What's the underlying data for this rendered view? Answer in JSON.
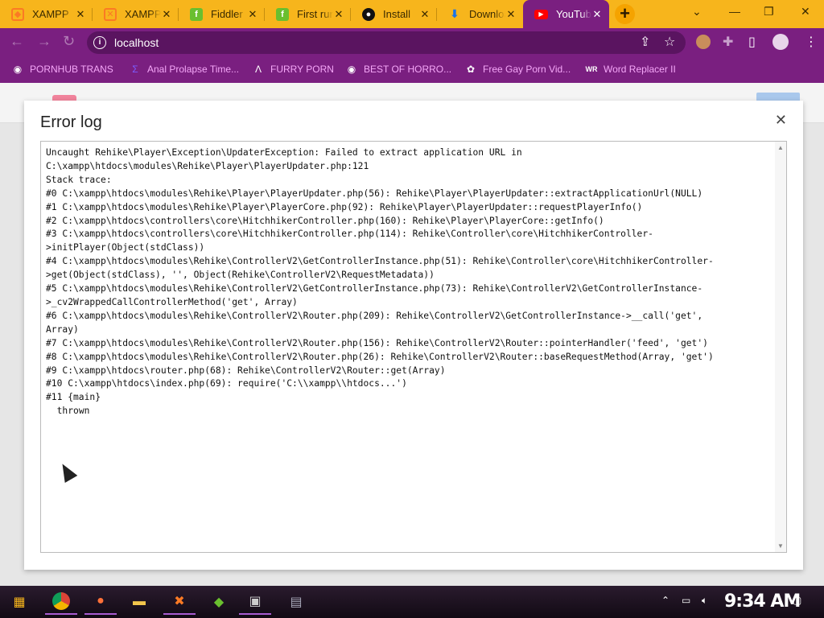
{
  "browser": {
    "tabs": [
      {
        "label": "XAMPP",
        "icon": "xampp-icon",
        "color": "#fb7a24"
      },
      {
        "label": "XAMPP",
        "icon": "xampp-icon",
        "color": "#fb7a24"
      },
      {
        "label": "Fiddler",
        "icon": "fiddler-icon",
        "color": "#6abf2f"
      },
      {
        "label": "First run",
        "icon": "fiddler-icon",
        "color": "#6abf2f"
      },
      {
        "label": "Install",
        "icon": "github-icon",
        "color": "#111111"
      },
      {
        "label": "Downloads",
        "icon": "download-icon",
        "color": "#1a73e8"
      },
      {
        "label": "YouTube",
        "icon": "youtube-icon",
        "color": "#ff0000"
      }
    ],
    "close_glyph": "✕",
    "new_tab_glyph": "+",
    "address": "localhost",
    "accent_color": "#7a1f80",
    "tabstrip_color": "#f7b51c"
  },
  "bookmarks": [
    {
      "label": "PORNHUB TRANS",
      "icon": "globe-icon"
    },
    {
      "label": "Anal Prolapse Time...",
      "icon": "bookmark-icon"
    },
    {
      "label": "FURRY PORN",
      "icon": "arrow-logo-icon"
    },
    {
      "label": "BEST OF HORRO...",
      "icon": "globe-icon"
    },
    {
      "label": "Free Gay Porn Vid...",
      "icon": "site-icon"
    },
    {
      "label": "Word Replacer II",
      "icon": "extension-icon"
    }
  ],
  "modal": {
    "title": "Error log",
    "close_glyph": "✕",
    "log": "Uncaught Rehike\\Player\\Exception\\UpdaterException: Failed to extract application URL in\nC:\\xampp\\htdocs\\modules\\Rehike\\Player\\PlayerUpdater.php:121\nStack trace:\n#0 C:\\xampp\\htdocs\\modules\\Rehike\\Player\\PlayerUpdater.php(56): Rehike\\Player\\PlayerUpdater::extractApplicationUrl(NULL)\n#1 C:\\xampp\\htdocs\\modules\\Rehike\\Player\\PlayerCore.php(92): Rehike\\Player\\PlayerUpdater::requestPlayerInfo()\n#2 C:\\xampp\\htdocs\\controllers\\core\\HitchhikerController.php(160): Rehike\\Player\\PlayerCore::getInfo()\n#3 C:\\xampp\\htdocs\\controllers\\core\\HitchhikerController.php(114): Rehike\\Controller\\core\\HitchhikerController-\n>initPlayer(Object(stdClass))\n#4 C:\\xampp\\htdocs\\modules\\Rehike\\ControllerV2\\GetControllerInstance.php(51): Rehike\\Controller\\core\\HitchhikerController-\n>get(Object(stdClass), '', Object(Rehike\\ControllerV2\\RequestMetadata))\n#5 C:\\xampp\\htdocs\\modules\\Rehike\\ControllerV2\\GetControllerInstance.php(73): Rehike\\ControllerV2\\GetControllerInstance-\n>_cv2WrappedCallControllerMethod('get', Array)\n#6 C:\\xampp\\htdocs\\modules\\Rehike\\ControllerV2\\Router.php(209): Rehike\\ControllerV2\\GetControllerInstance->__call('get',\nArray)\n#7 C:\\xampp\\htdocs\\modules\\Rehike\\ControllerV2\\Router.php(156): Rehike\\ControllerV2\\Router::pointerHandler('feed', 'get')\n#8 C:\\xampp\\htdocs\\modules\\Rehike\\ControllerV2\\Router.php(26): Rehike\\ControllerV2\\Router::baseRequestMethod(Array, 'get')\n#9 C:\\xampp\\htdocs\\router.php(68): Rehike\\ControllerV2\\Router::get(Array)\n#10 C:\\xampp\\htdocs\\index.php(69): require('C:\\\\xampp\\\\htdocs...')\n#11 {main}\n  thrown"
  },
  "taskbar": {
    "clock": "9:34 AM"
  }
}
